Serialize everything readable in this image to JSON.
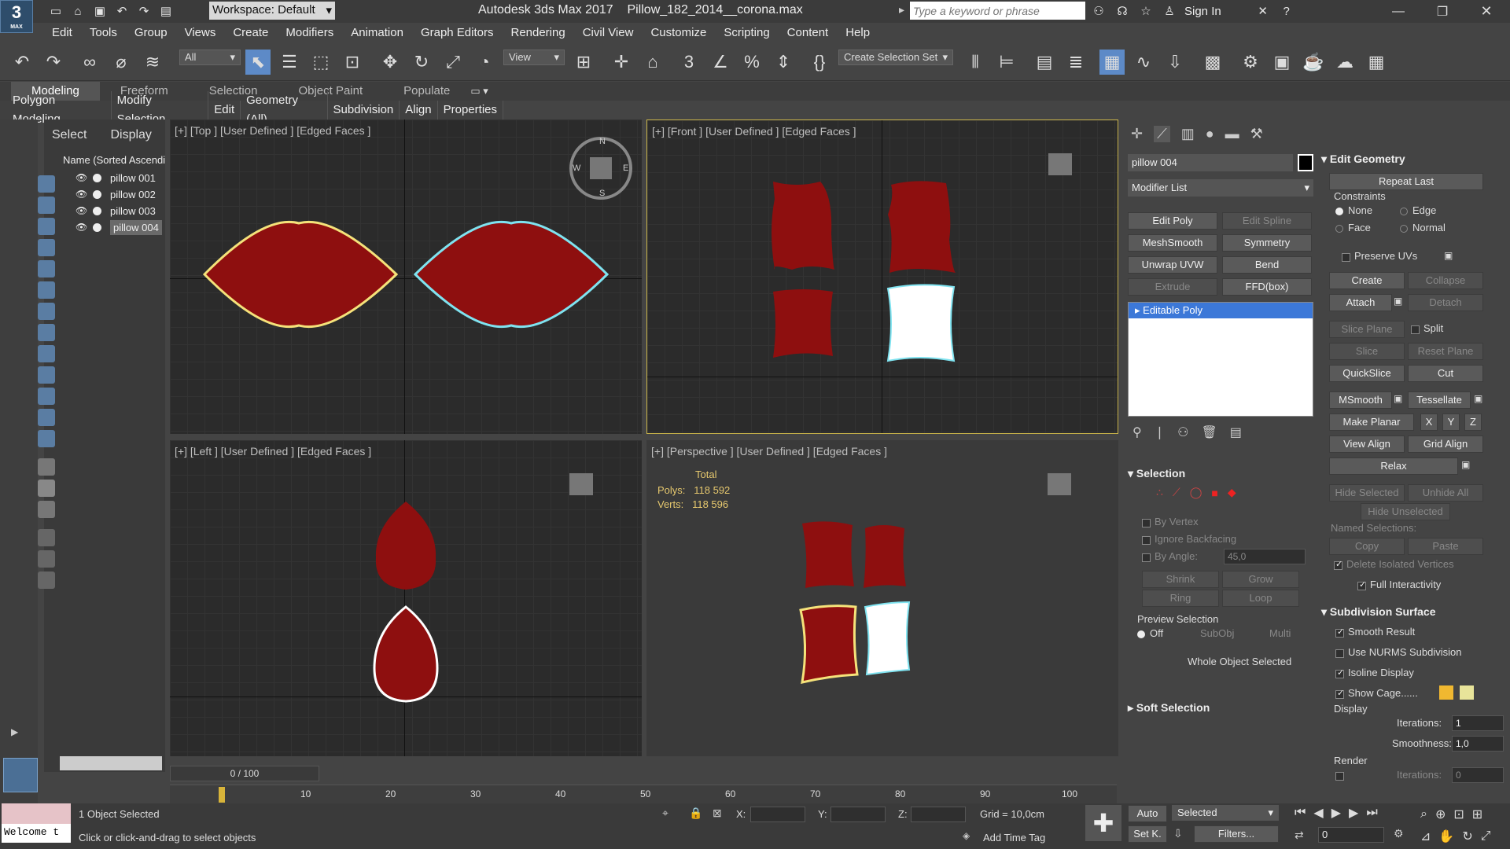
{
  "app": {
    "title": "Autodesk 3ds Max 2017",
    "file": "Pillow_182_2014__corona.max",
    "logo": "3",
    "logo_sub": "MAX"
  },
  "workspace": {
    "label": "Workspace: Default"
  },
  "search": {
    "placeholder": "Type a keyword or phrase"
  },
  "account": {
    "sign_in": "Sign In"
  },
  "menus": [
    "Edit",
    "Tools",
    "Group",
    "Views",
    "Create",
    "Modifiers",
    "Animation",
    "Graph Editors",
    "Rendering",
    "Civil View",
    "Customize",
    "Scripting",
    "Content",
    "Help"
  ],
  "toolbar": {
    "filter": "All",
    "ref_coord": "View",
    "selection_set": "Create Selection Set"
  },
  "ribbon": {
    "tabs": [
      "Modeling",
      "Freeform",
      "Selection",
      "Object Paint",
      "Populate"
    ],
    "active_tab": "Modeling",
    "sub": [
      "Polygon Modeling",
      "Modify Selection",
      "Edit",
      "Geometry (All)",
      "Subdivision",
      "Align",
      "Properties"
    ]
  },
  "scene_explorer": {
    "tabs": [
      "Select",
      "Display"
    ],
    "column": "Name (Sorted Ascendi",
    "items": [
      "pillow 001",
      "pillow 002",
      "pillow 003",
      "pillow 004"
    ],
    "selected": "pillow 004"
  },
  "viewports": {
    "top": "[+] [Top ] [User Defined ] [Edged Faces ]",
    "front": "[+] [Front ] [User Defined ] [Edged Faces ]",
    "left": "[+] [Left ] [User Defined ] [Edged Faces ]",
    "perspective": "[+] [Perspective ] [User Defined ] [Edged Faces ]",
    "stats": {
      "total": "Total",
      "polys_label": "Polys:",
      "polys": "118 592",
      "verts_label": "Verts:",
      "verts": "118 596"
    },
    "compass": {
      "n": "N",
      "s": "S",
      "e": "E",
      "w": "W"
    }
  },
  "command_panel": {
    "object_name": "pillow 004",
    "modifier_list": "Modifier List",
    "buttons": [
      "Edit Poly",
      "Edit Spline",
      "MeshSmooth",
      "Symmetry",
      "Unwrap UVW",
      "Bend",
      "Extrude",
      "FFD(box)"
    ],
    "stack_item": "Editable Poly",
    "selection": {
      "title": "Selection",
      "by_vertex": "By Vertex",
      "ignore_backfacing": "Ignore Backfacing",
      "by_angle": "By Angle:",
      "angle_value": "45,0",
      "shrink": "Shrink",
      "grow": "Grow",
      "ring": "Ring",
      "loop": "Loop",
      "preview_title": "Preview Selection",
      "preview_off": "Off",
      "preview_subobj": "SubObj",
      "preview_multi": "Multi",
      "status": "Whole Object Selected"
    },
    "soft_selection": "Soft Selection"
  },
  "edit_geometry": {
    "title": "Edit Geometry",
    "repeat_last": "Repeat Last",
    "constraints": "Constraints",
    "c_none": "None",
    "c_edge": "Edge",
    "c_face": "Face",
    "c_normal": "Normal",
    "preserve_uvs": "Preserve UVs",
    "create": "Create",
    "collapse": "Collapse",
    "attach": "Attach",
    "detach": "Detach",
    "slice_plane": "Slice Plane",
    "split": "Split",
    "slice": "Slice",
    "reset_plane": "Reset Plane",
    "quickslice": "QuickSlice",
    "cut": "Cut",
    "msmooth": "MSmooth",
    "tessellate": "Tessellate",
    "make_planar": "Make Planar",
    "x": "X",
    "y": "Y",
    "z": "Z",
    "view_align": "View Align",
    "grid_align": "Grid Align",
    "relax": "Relax",
    "hide_selected": "Hide Selected",
    "unhide_all": "Unhide All",
    "hide_unselected": "Hide Unselected",
    "named_selections": "Named Selections:",
    "copy": "Copy",
    "paste": "Paste",
    "delete_isolated": "Delete Isolated Vertices",
    "full_interactivity": "Full Interactivity"
  },
  "subdivision": {
    "title": "Subdivision Surface",
    "smooth_result": "Smooth Result",
    "use_nurms": "Use NURMS Subdivision",
    "isoline": "Isoline Display",
    "show_cage": "Show Cage......",
    "display": "Display",
    "iterations_label": "Iterations:",
    "iterations": "1",
    "smoothness_label": "Smoothness:",
    "smoothness": "1,0",
    "render": "Render",
    "r_iterations": "0",
    "cage_color1": "#f0b830",
    "cage_color2": "#e8e49a"
  },
  "timeline": {
    "frame": "0 / 100",
    "ticks": [
      "10",
      "20",
      "30",
      "40",
      "50",
      "60",
      "70",
      "80",
      "90",
      "100"
    ]
  },
  "status": {
    "objects": "1 Object Selected",
    "prompt": "Click or click-and-drag to select objects",
    "script": "Welcome t",
    "x": "X:",
    "y": "Y:",
    "z": "Z:",
    "grid": "Grid = 10,0cm",
    "add_time_tag": "Add Time Tag",
    "auto": "Auto",
    "selected": "Selected",
    "setk": "Set K.",
    "filters": "Filters...",
    "frame": "0"
  },
  "colors": {
    "pillow_red": "#8e0f0f",
    "selected_white": "#ffffff",
    "highlight_yellow": "#f5e27a",
    "highlight_cyan": "#7fe3f0",
    "accent_blue": "#5d8ac7"
  }
}
